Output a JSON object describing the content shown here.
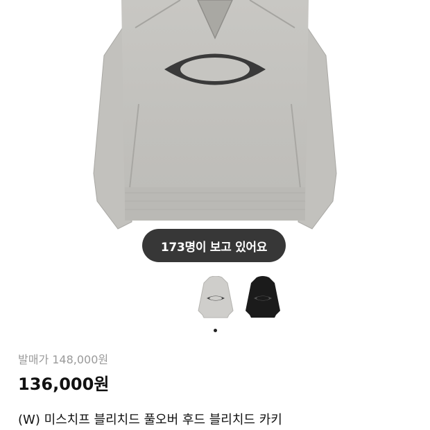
{
  "product": {
    "viewers_text": "173명이 보고 있어요",
    "original_price": "발매가 148,000원",
    "sale_price": "136,000원",
    "name": "(W) 미스치프 블리치드 풀오버 후드 블리치드 카키"
  },
  "gallery": {
    "thumbnails": [
      {
        "color_name": "bleached khaki",
        "selected": true
      },
      {
        "color_name": "black",
        "selected": false
      }
    ]
  },
  "colors": {
    "hoodie_gray": "#c9c8c5",
    "hoodie_black": "#1b1b1b",
    "badge_bg": "#282828",
    "muted_text": "#9a9a9a",
    "main_text": "#111111"
  }
}
